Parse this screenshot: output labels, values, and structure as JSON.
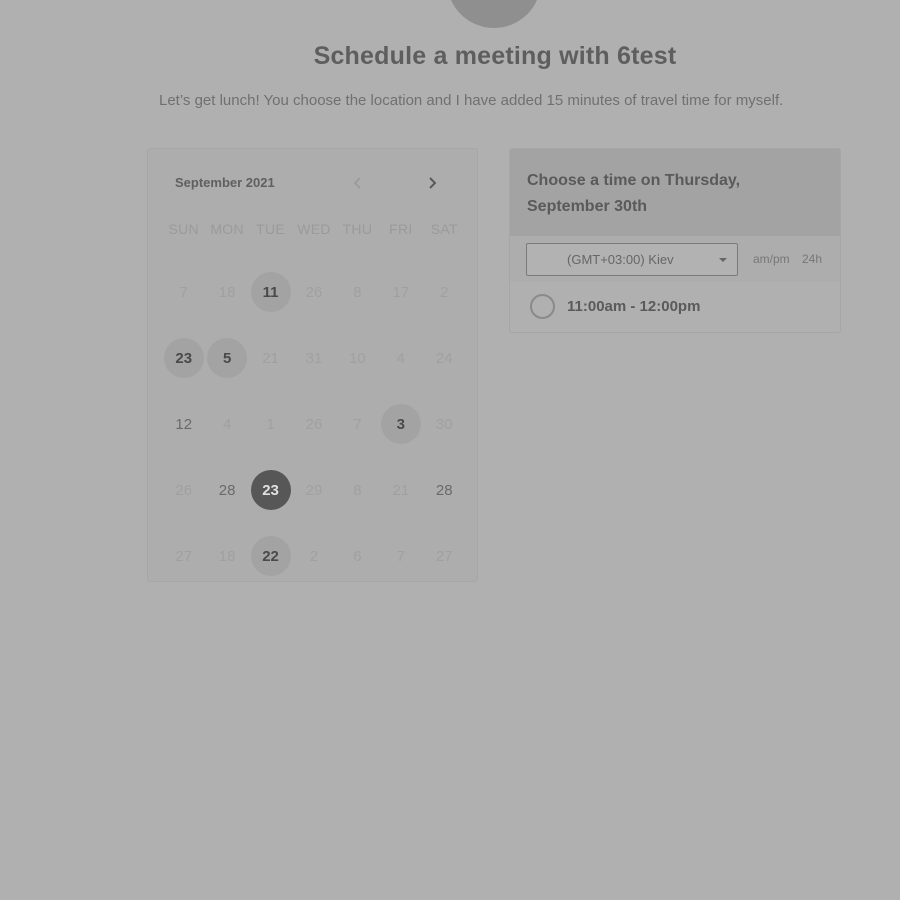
{
  "header": {
    "title": "Schedule a meeting with 6test",
    "subtitle": "Let’s get lunch! You choose the location and I have added 15 minutes of travel time for myself."
  },
  "calendar": {
    "month_label": "September 2021",
    "prev_icon": "chevron-left-icon",
    "next_icon": "chevron-right-icon",
    "weekdays": [
      "SUN",
      "MON",
      "TUE",
      "WED",
      "THU",
      "FRI",
      "SAT"
    ],
    "days": [
      {
        "label": "7",
        "state": "disabled"
      },
      {
        "label": "18",
        "state": "disabled"
      },
      {
        "label": "11",
        "state": "available"
      },
      {
        "label": "26",
        "state": "disabled"
      },
      {
        "label": "8",
        "state": "disabled"
      },
      {
        "label": "17",
        "state": "disabled"
      },
      {
        "label": "2",
        "state": "disabled"
      },
      {
        "label": "23",
        "state": "available"
      },
      {
        "label": "5",
        "state": "available"
      },
      {
        "label": "21",
        "state": "disabled"
      },
      {
        "label": "31",
        "state": "disabled"
      },
      {
        "label": "10",
        "state": "disabled"
      },
      {
        "label": "4",
        "state": "disabled"
      },
      {
        "label": "24",
        "state": "disabled"
      },
      {
        "label": "12",
        "state": "plain"
      },
      {
        "label": "4",
        "state": "disabled"
      },
      {
        "label": "1",
        "state": "disabled"
      },
      {
        "label": "26",
        "state": "disabled"
      },
      {
        "label": "7",
        "state": "disabled"
      },
      {
        "label": "3",
        "state": "available"
      },
      {
        "label": "30",
        "state": "disabled"
      },
      {
        "label": "26",
        "state": "disabled"
      },
      {
        "label": "28",
        "state": "plain"
      },
      {
        "label": "23",
        "state": "selected"
      },
      {
        "label": "29",
        "state": "disabled"
      },
      {
        "label": "8",
        "state": "disabled"
      },
      {
        "label": "21",
        "state": "disabled"
      },
      {
        "label": "28",
        "state": "plain"
      },
      {
        "label": "27",
        "state": "disabled"
      },
      {
        "label": "18",
        "state": "disabled"
      },
      {
        "label": "22",
        "state": "available"
      },
      {
        "label": "2",
        "state": "disabled"
      },
      {
        "label": "6",
        "state": "disabled"
      },
      {
        "label": "7",
        "state": "disabled"
      },
      {
        "label": "27",
        "state": "disabled"
      }
    ]
  },
  "times": {
    "heading": "Choose a time on Thursday, September 30th",
    "timezone_value": "(GMT+03:00) Kiev",
    "format_ampm": "am/pm",
    "format_24h": "24h",
    "slots": [
      {
        "label": "11:00am - 12:00pm"
      }
    ]
  },
  "colors": {
    "background": "#b0b0b0",
    "selected_day": "#575757",
    "available_day": "#a3a3a3"
  }
}
